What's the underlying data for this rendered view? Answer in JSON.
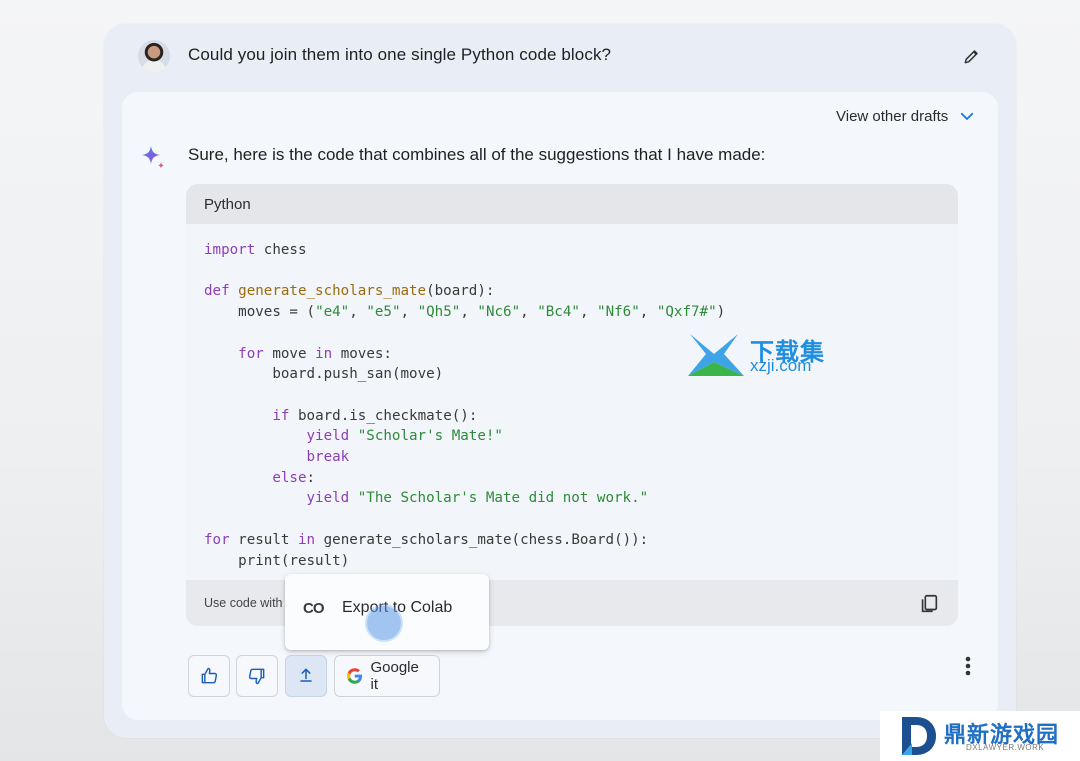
{
  "prompt": {
    "text": "Could you join them into one single Python code block?"
  },
  "response": {
    "drafts_label": "View other drafts",
    "intro": "Sure, here is the code that combines all of the suggestions that I have made:",
    "code_language": "Python",
    "code_lines": [
      "import chess",
      "",
      "def generate_scholars_mate(board):",
      "    moves = (\"e4\", \"e5\", \"Qh5\", \"Nc6\", \"Bc4\", \"Nf6\", \"Qxf7#\")",
      "",
      "    for move in moves:",
      "        board.push_san(move)",
      "",
      "        if board.is_checkmate():",
      "            yield \"Scholar's Mate!\"",
      "            break",
      "        else:",
      "            yield \"The Scholar's Mate did not work.\"",
      "",
      "for result in generate_scholars_mate(chess.Board()):",
      "    print(result)"
    ],
    "use_code_label": "Use code with",
    "export_menu": {
      "logo": "CO",
      "label": "Export to Colab"
    },
    "actions": {
      "google_it": "Google it"
    }
  },
  "watermarks": {
    "site1_cn": "下载集",
    "site1_url": "xzji.com",
    "site2_cn": "鼎新游戏园",
    "site2_url": "DXLAWYER.WORK"
  },
  "colors": {
    "keyword": "#8c3fb6",
    "function": "#9b6b0f",
    "string": "#2f8a3a",
    "accent": "#1a73e8"
  },
  "icons": {
    "edit": "pencil-icon",
    "drafts": "chevron-down-icon",
    "gemini": "sparkle-icon",
    "copy": "copy-icon",
    "like": "thumbs-up-icon",
    "dislike": "thumbs-down-icon",
    "share": "share-icon",
    "google": "google-g-icon",
    "more": "more-vertical-icon"
  }
}
